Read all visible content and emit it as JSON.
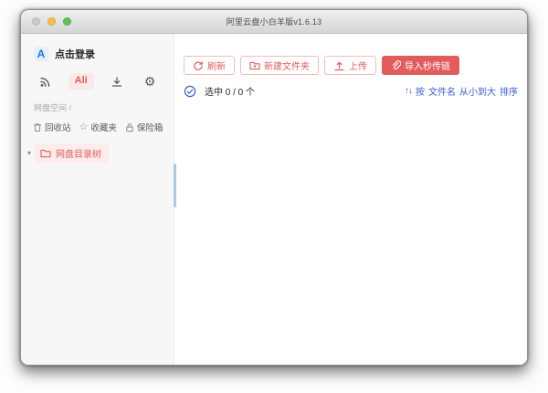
{
  "window": {
    "title": "阿里云盘小白羊版v1.6.13"
  },
  "sidebar": {
    "login": {
      "logo_letter": "A",
      "label": "点击登录"
    },
    "tabs": {
      "ali_label": "Ali"
    },
    "section_label": "网盘空间 /",
    "quick_items": [
      {
        "label": "回收站"
      },
      {
        "label": "收藏夹"
      },
      {
        "label": "保险箱"
      }
    ],
    "tree_item": {
      "label": "网盘目录树"
    }
  },
  "toolbar": {
    "refresh_label": "刷新",
    "new_folder_label": "新建文件夹",
    "upload_label": "上传",
    "import_label": "导入秒传链"
  },
  "status_row": {
    "selected_label": "选中 0 / 0 个",
    "sort_prefix": "按",
    "sort_field": "文件名",
    "sort_order": "从小到大",
    "sort_suffix": "排序"
  },
  "icons": {
    "gear": "⚙",
    "star": "☆",
    "caret_down": "▾",
    "sort_arrows": "↑↓"
  },
  "colors": {
    "accent_red": "#e25c5c",
    "accent_red_bg": "#fdecec",
    "accent_blue": "#3a5ccc",
    "logo_blue": "#1677ff",
    "sidebar_bg": "#f7f7f8",
    "scrollbar_blue": "#abc9e5",
    "traffic_grey": "#c9c9c9",
    "traffic_yellow": "#f5bd4c",
    "traffic_green": "#5fc454"
  }
}
